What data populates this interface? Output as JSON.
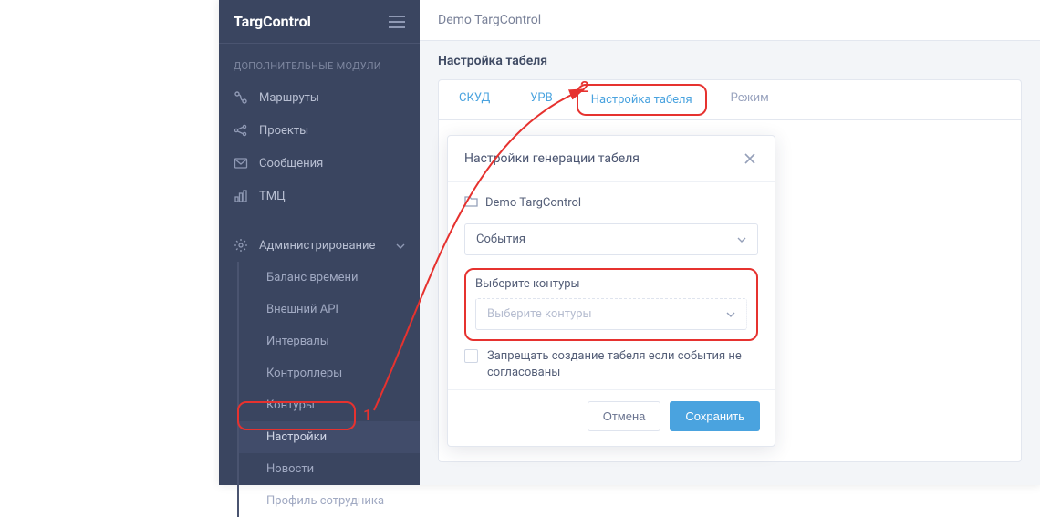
{
  "logo": "TargControl",
  "sidebar": {
    "section_title": "ДОПОЛНИТЕЛЬНЫЕ МОДУЛИ",
    "items": [
      {
        "label": "Маршруты"
      },
      {
        "label": "Проекты"
      },
      {
        "label": "Сообщения"
      },
      {
        "label": "ТМЦ"
      }
    ],
    "admin_label": "Администрирование",
    "admin_items": [
      {
        "label": "Баланс времени"
      },
      {
        "label": "Внешний API"
      },
      {
        "label": "Интервалы"
      },
      {
        "label": "Контроллеры"
      },
      {
        "label": "Контуры"
      },
      {
        "label": "Настройки"
      },
      {
        "label": "Новости"
      },
      {
        "label": "Профиль сотрудника"
      }
    ]
  },
  "topbar": {
    "org": "Demo TargControl"
  },
  "page": {
    "title": "Настройка табеля"
  },
  "tabs": [
    {
      "label": "СКУД"
    },
    {
      "label": "УРВ"
    },
    {
      "label": "Настройка табеля"
    },
    {
      "label": "Режим"
    }
  ],
  "modal": {
    "title": "Настройки генерации табеля",
    "folder": "Demo TargControl",
    "select_events": "События",
    "contours_label": "Выберите контуры",
    "contours_placeholder": "Выберите контуры",
    "forbid_checkbox": "Запрещать создание табеля если события не согласованы",
    "cancel": "Отмена",
    "save": "Сохранить"
  },
  "annotations": {
    "one": "1",
    "two": "2"
  }
}
